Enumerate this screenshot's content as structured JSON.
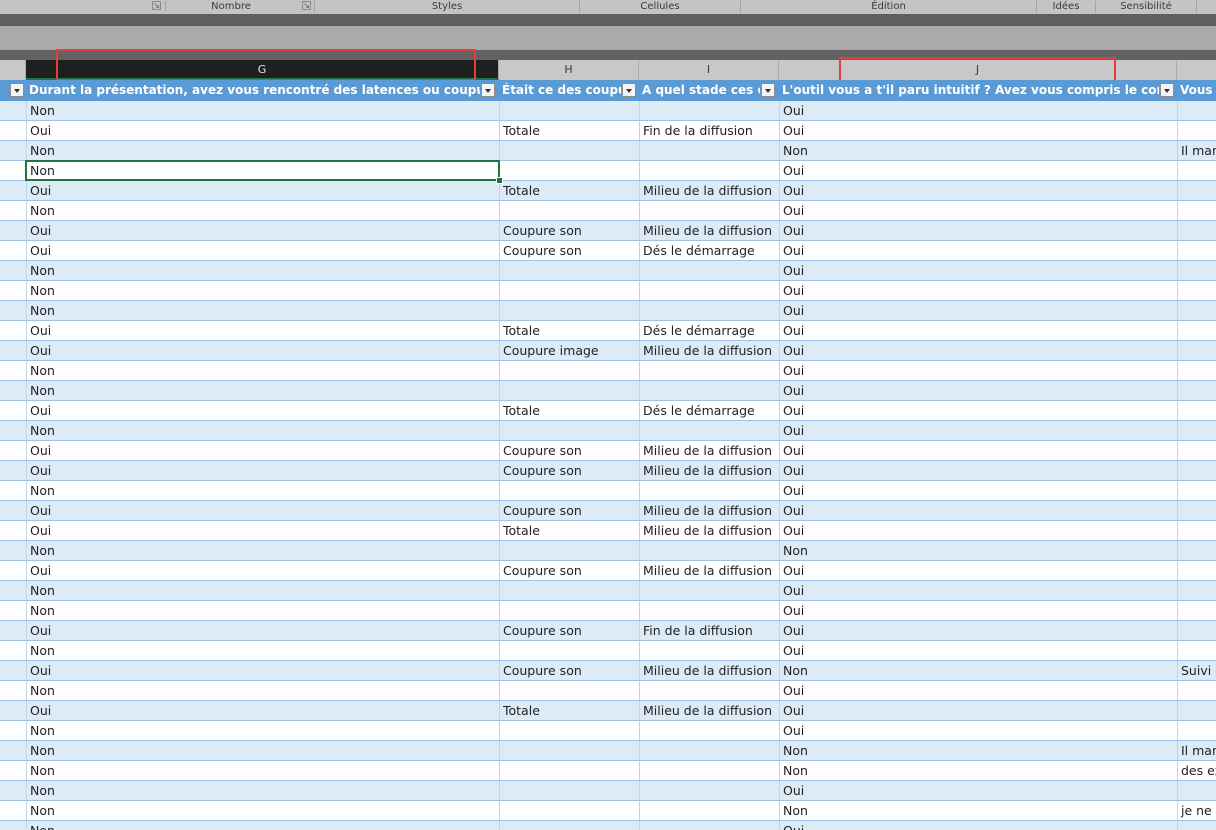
{
  "ribbon": {
    "groups": [
      "Nombre",
      "Styles",
      "Cellules",
      "Édition",
      "Idées",
      "Sensibilité"
    ]
  },
  "columns": [
    "G",
    "H",
    "I",
    "J"
  ],
  "selected_column": "G",
  "table": {
    "headers": [
      "Durant la présentation, avez vous rencontré des latences ou coupures ?",
      "Était ce des coupures",
      "A quel stade ces coupures",
      "L'outil vous a t'il paru intuitif ? Avez vous compris le concept de",
      "Vous a"
    ],
    "rows": [
      [
        "Non",
        "",
        "",
        "Oui",
        ""
      ],
      [
        "Oui",
        "Totale",
        "Fin de la diffusion",
        "Oui",
        ""
      ],
      [
        "Non",
        "",
        "",
        "Non",
        "Il man"
      ],
      [
        "Non",
        "",
        "",
        "Oui",
        ""
      ],
      [
        "Oui",
        "Totale",
        "Milieu de la diffusion",
        "Oui",
        ""
      ],
      [
        "Non",
        "",
        "",
        "Oui",
        ""
      ],
      [
        "Oui",
        "Coupure son",
        "Milieu de la diffusion",
        "Oui",
        ""
      ],
      [
        "Oui",
        "Coupure son",
        "Dés le démarrage",
        "Oui",
        ""
      ],
      [
        "Non",
        "",
        "",
        "Oui",
        ""
      ],
      [
        "Non",
        "",
        "",
        "Oui",
        ""
      ],
      [
        "Non",
        "",
        "",
        "Oui",
        ""
      ],
      [
        "Oui",
        "Totale",
        "Dés le démarrage",
        "Oui",
        ""
      ],
      [
        "Oui",
        "Coupure image",
        "Milieu de la diffusion",
        "Oui",
        ""
      ],
      [
        "Non",
        "",
        "",
        "Oui",
        ""
      ],
      [
        "Non",
        "",
        "",
        "Oui",
        ""
      ],
      [
        "Oui",
        "Totale",
        "Dés le démarrage",
        "Oui",
        ""
      ],
      [
        "Non",
        "",
        "",
        "Oui",
        ""
      ],
      [
        "Oui",
        "Coupure son",
        "Milieu de la diffusion",
        "Oui",
        ""
      ],
      [
        "Oui",
        "Coupure son",
        "Milieu de la diffusion",
        "Oui",
        ""
      ],
      [
        "Non",
        "",
        "",
        "Oui",
        ""
      ],
      [
        "Oui",
        "Coupure son",
        "Milieu de la diffusion",
        "Oui",
        ""
      ],
      [
        "Oui",
        "Totale",
        "Milieu de la diffusion",
        "Oui",
        ""
      ],
      [
        "Non",
        "",
        "",
        "Non",
        ""
      ],
      [
        "Oui",
        "Coupure son",
        "Milieu de la diffusion",
        "Oui",
        ""
      ],
      [
        "Non",
        "",
        "",
        "Oui",
        ""
      ],
      [
        "Non",
        "",
        "",
        "Oui",
        ""
      ],
      [
        "Oui",
        "Coupure son",
        "Fin de la diffusion",
        "Oui",
        ""
      ],
      [
        "Non",
        "",
        "",
        "Oui",
        ""
      ],
      [
        "Oui",
        "Coupure son",
        "Milieu de la diffusion",
        "Non",
        "Suivi d"
      ],
      [
        "Non",
        "",
        "",
        "Oui",
        ""
      ],
      [
        "Oui",
        "Totale",
        "Milieu de la diffusion",
        "Oui",
        ""
      ],
      [
        "Non",
        "",
        "",
        "Oui",
        ""
      ],
      [
        "Non",
        "",
        "",
        "Non",
        "Il man"
      ],
      [
        "Non",
        "",
        "",
        "Non",
        "des ex"
      ],
      [
        "Non",
        "",
        "",
        "Oui",
        ""
      ],
      [
        "Non",
        "",
        "",
        "Non",
        "je ne s"
      ],
      [
        "Non",
        "",
        "",
        "Oui",
        ""
      ]
    ]
  },
  "colors": {
    "header_blue": "#5b9bd5",
    "band_row": "#ddebf7",
    "selection_green": "#217346",
    "annotation_red": "#e0403d"
  }
}
